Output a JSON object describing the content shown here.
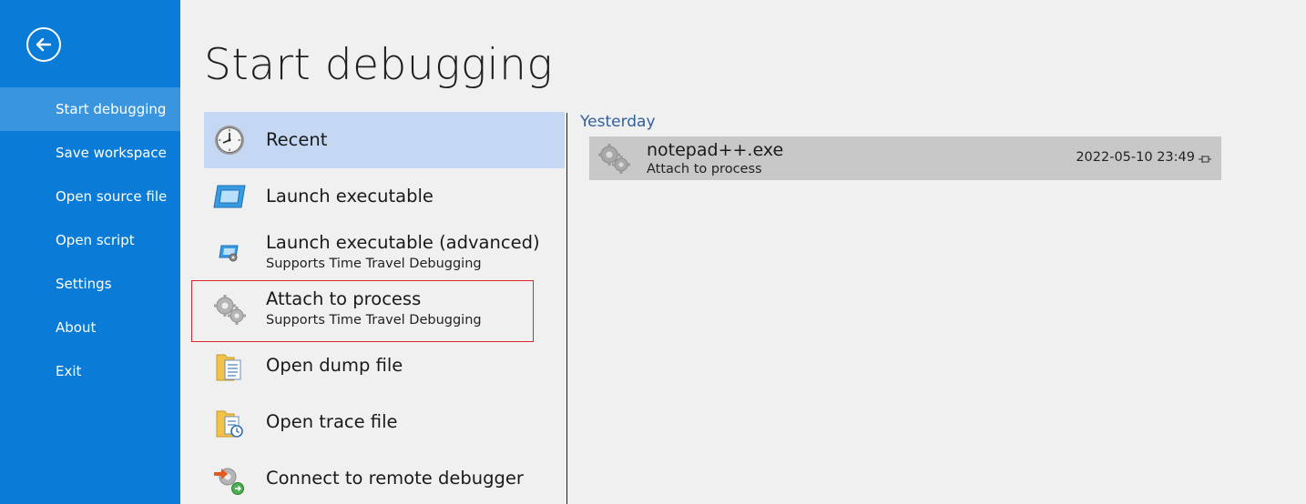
{
  "sidebar": {
    "items": [
      {
        "label": "Start debugging",
        "active": true
      },
      {
        "label": "Save workspace"
      },
      {
        "label": "Open source file"
      },
      {
        "label": "Open script"
      },
      {
        "label": "Settings"
      },
      {
        "label": "About"
      },
      {
        "label": "Exit"
      }
    ]
  },
  "page": {
    "title": "Start debugging"
  },
  "options": [
    {
      "label": "Recent",
      "icon": "clock-icon",
      "selected": true
    },
    {
      "label": "Launch executable",
      "icon": "window-icon"
    },
    {
      "label": "Launch executable (advanced)",
      "sub": "Supports Time Travel Debugging",
      "icon": "window-gear-icon"
    },
    {
      "label": "Attach to process",
      "sub": "Supports Time Travel Debugging",
      "icon": "gears-icon",
      "highlighted": true
    },
    {
      "label": "Open dump file",
      "icon": "folder-document-icon"
    },
    {
      "label": "Open trace file",
      "icon": "folder-trace-icon"
    },
    {
      "label": "Connect to remote debugger",
      "icon": "remote-connect-icon"
    }
  ],
  "recent": {
    "group": "Yesterday",
    "items": [
      {
        "name": "notepad++.exe",
        "sub": "Attach to process",
        "date": "2022-05-10 23:49",
        "icon": "gears-icon"
      }
    ]
  },
  "colors": {
    "sidebar_bg": "#0a7bd6",
    "sidebar_active": "#3a95df",
    "selected_option": "#c5d8f3",
    "highlight_border": "#d9262e",
    "group_header": "#2f5f9d",
    "recent_item_bg": "#c8c8c8"
  }
}
